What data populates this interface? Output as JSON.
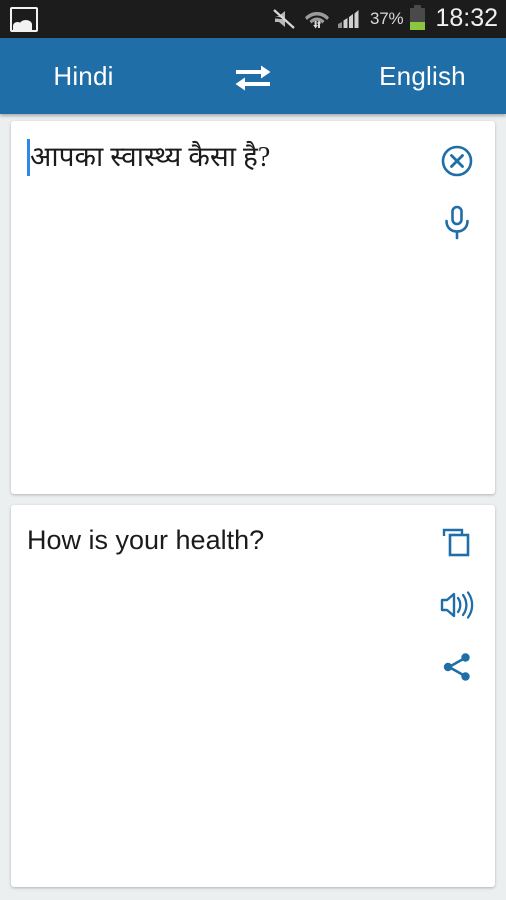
{
  "statusbar": {
    "notification_icon": "gallery-icon",
    "icons": [
      "mute-icon",
      "wifi-icon",
      "cell-signal-icon"
    ],
    "battery_percent": "37%",
    "battery_level": 37,
    "battery_color": "#8cc63e",
    "time": "18:32",
    "background": "#1c1c1c"
  },
  "toolbar": {
    "source_language": "Hindi",
    "target_language": "English",
    "swap_icon": "swap-horizontal-icon",
    "background": "#1f6ea8",
    "text_color": "#ffffff"
  },
  "input_card": {
    "text": "आपका स्वास्थ्य कैसा है?",
    "placeholder": "Enter text",
    "has_caret": true,
    "caret_color": "#2d8ae0",
    "actions": [
      {
        "name": "clear-button",
        "icon": "close-circle-icon"
      },
      {
        "name": "microphone-button",
        "icon": "microphone-icon"
      }
    ]
  },
  "output_card": {
    "text": "How is your health?",
    "actions": [
      {
        "name": "copy-button",
        "icon": "copy-icon"
      },
      {
        "name": "speak-button",
        "icon": "speaker-icon"
      },
      {
        "name": "share-button",
        "icon": "share-icon"
      }
    ]
  },
  "colors": {
    "accent": "#1f6ea8",
    "icon_blue": "#1f6ea8",
    "page_background": "#eceff0",
    "card_background": "#ffffff",
    "text": "#1b1b1b"
  }
}
